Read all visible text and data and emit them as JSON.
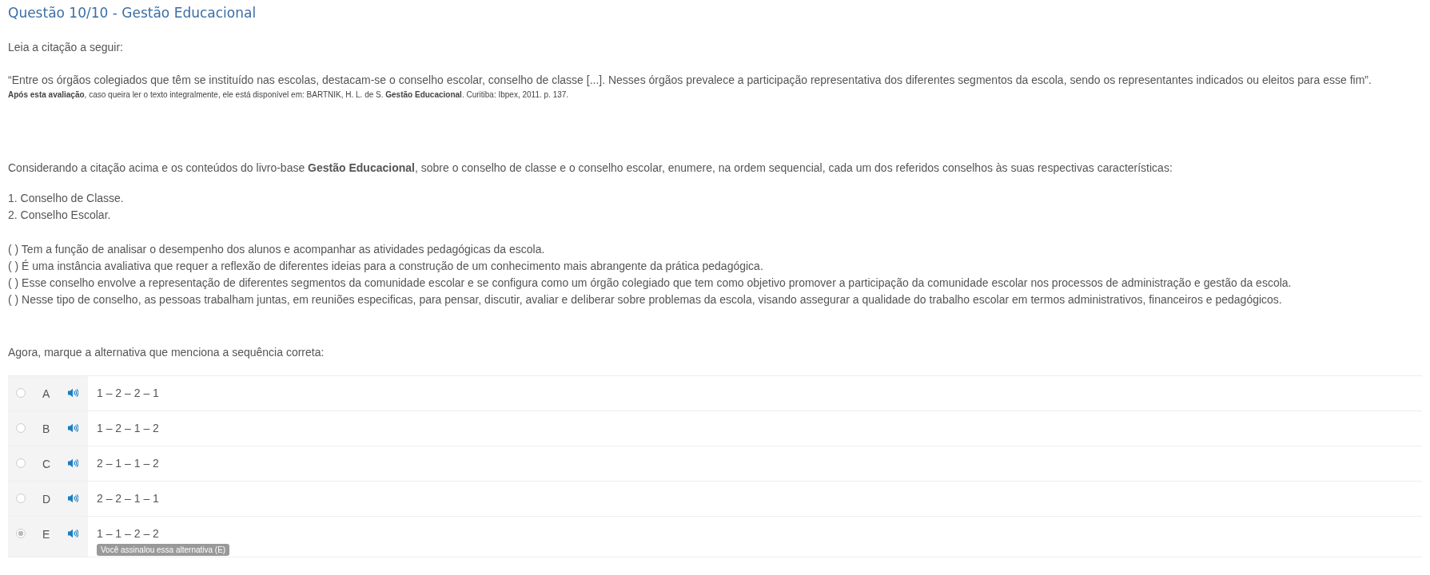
{
  "title": "Questão 10/10 - Gestão Educacional",
  "intro": "Leia a citação a seguir:",
  "quote": "“Entre os órgãos colegiados que têm se instituído nas escolas, destacam-se o conselho escolar, conselho de classe [...]. Nesses órgãos prevalece a participação representativa dos diferentes segmentos da escola, sendo os representantes indicados ou eleitos para esse fim”.",
  "source": "**Após esta avaliação**, caso queira ler o texto integralmente, ele está disponível em: BARTNIK, H. L. de S. **Gestão Educacional**. Curitiba: Ibpex, 2011. p. 137.",
  "prompt": "Considerando a citação acima e os conteúdos do livro-base **Gestão Educacional**, sobre o conselho de classe e o conselho escolar, enumere, na ordem sequencial, cada um dos referidos conselhos às suas respectivas características:",
  "numbered": [
    "1. Conselho de Classe.",
    "2. Conselho Escolar."
  ],
  "statements": [
    "(  ) Tem a função de analisar o desempenho dos alunos e acompanhar as atividades pedagógicas da escola.",
    "(  ) É uma instância avaliativa que requer a reflexão de diferentes ideias para a construção de um conhecimento mais abrangente da prática pedagógica.",
    "(  ) Esse conselho envolve a representação de diferentes segmentos da comunidade escolar e se configura como um órgão colegiado que tem como objetivo promover a participação da comunidade escolar nos processos de administração e gestão da escola.",
    "( ) Nesse tipo de conselho, as pessoas trabalham juntas, em reuniões especificas, para pensar, discutir, avaliar e deliberar sobre problemas da escola, visando assegurar a qualidade do trabalho escolar em termos administrativos, financeiros e pedagógicos."
  ],
  "instruction": "Agora, marque a alternativa que menciona a sequência correta:",
  "options": [
    {
      "letter": "A",
      "text": "1 – 2 – 2 – 1",
      "selected": false
    },
    {
      "letter": "B",
      "text": "1 – 2 – 1 – 2",
      "selected": false
    },
    {
      "letter": "C",
      "text": "2 – 1 – 1 – 2",
      "selected": false
    },
    {
      "letter": "D",
      "text": "2 – 2 – 1 – 1",
      "selected": false
    },
    {
      "letter": "E",
      "text": "1 – 1 – 2 – 2",
      "selected": true,
      "note": "Você assinalou essa alternativa (E)"
    }
  ]
}
